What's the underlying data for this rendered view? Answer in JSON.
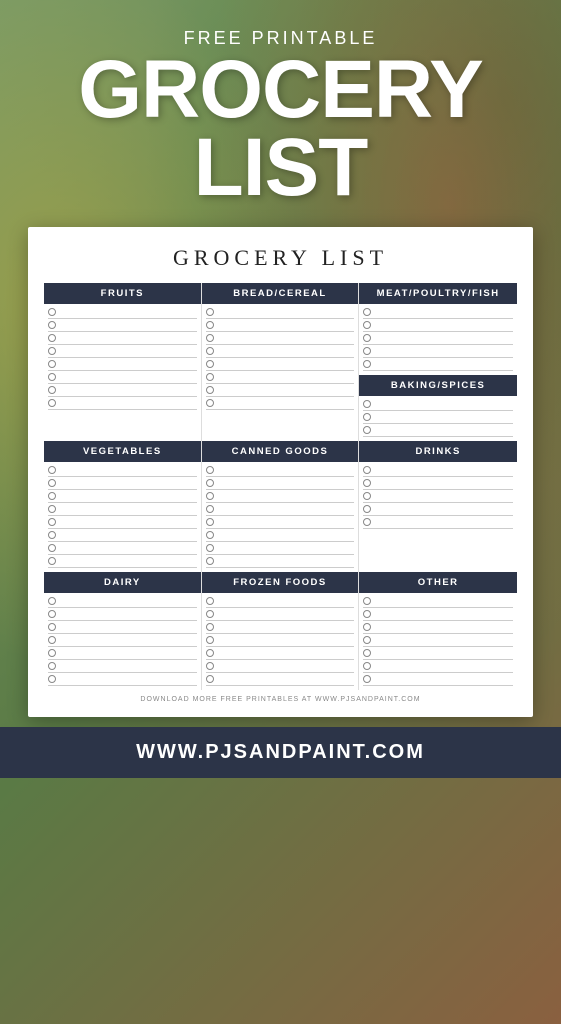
{
  "header": {
    "subtitle": "FREE PRINTABLE",
    "title_line1": "GROCERY",
    "title_line2": "LIST"
  },
  "card": {
    "title": "GROCERY LIST",
    "sections": {
      "fruits": "FRUITS",
      "bread": "BREAD/CEREAL",
      "meat": "MEAT/POULTRY/FISH",
      "vegetables": "VEGETABLES",
      "canned": "CANNED GOODS",
      "baking": "BAKING/SPICES",
      "dairy": "DAIRY",
      "frozen": "FROZEN FOODS",
      "drinks": "DRINKS",
      "other": "OTHER"
    },
    "items_count": 8,
    "credit": "DOWNLOAD MORE FREE PRINTABLES AT WWW.PJSANDPAINT.COM"
  },
  "footer": {
    "url": "WWW.PJSANDPAINT.COM"
  }
}
